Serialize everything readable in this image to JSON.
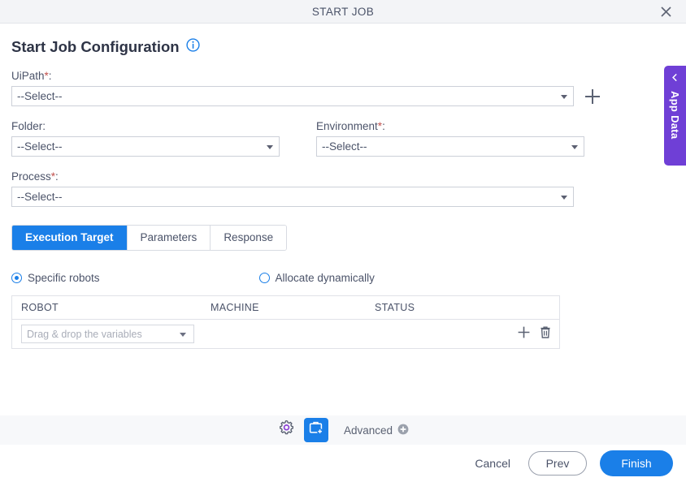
{
  "window": {
    "title": "START JOB",
    "close_icon": "close-icon"
  },
  "page": {
    "heading": "Start Job Configuration",
    "info_icon": "info-icon"
  },
  "form": {
    "uipath": {
      "label": "UiPath",
      "required_marker": "*",
      "colon": ":",
      "value": "--Select--",
      "add_icon": "plus-icon"
    },
    "folder": {
      "label": "Folder",
      "colon": ":",
      "value": "--Select--"
    },
    "environment": {
      "label": "Environment",
      "required_marker": "*",
      "colon": ":",
      "value": "--Select--"
    },
    "process": {
      "label": "Process",
      "required_marker": "*",
      "colon": ":",
      "value": "--Select--"
    }
  },
  "tabs": [
    {
      "label": "Execution Target",
      "active": true
    },
    {
      "label": "Parameters",
      "active": false
    },
    {
      "label": "Response",
      "active": false
    }
  ],
  "allocation": {
    "specific": {
      "label": "Specific robots",
      "selected": true
    },
    "dynamic": {
      "label": "Allocate dynamically",
      "selected": false
    }
  },
  "grid": {
    "columns": [
      "ROBOT",
      "MACHINE",
      "STATUS"
    ],
    "rows": [
      {
        "robot_placeholder": "Drag & drop the variables",
        "machine": "",
        "status": "",
        "add_icon": "plus-icon",
        "delete_icon": "trash-icon"
      }
    ]
  },
  "side_panel": {
    "label": "App Data",
    "collapse_icon": "chevron-left-icon"
  },
  "toolbar": {
    "settings_icon": "gear-icon",
    "job_icon": "briefcase-add-icon",
    "advanced_label": "Advanced",
    "advanced_badge_icon": "plus-circle-icon"
  },
  "footer": {
    "cancel": "Cancel",
    "prev": "Prev",
    "finish": "Finish"
  },
  "colors": {
    "accent_blue": "#1a7fe8",
    "app_data_purple": "#6f3fd6",
    "required_red": "#c0504d",
    "titlebar_bg": "#f3f4f7",
    "toolbar_bg": "#f7f8fa"
  }
}
